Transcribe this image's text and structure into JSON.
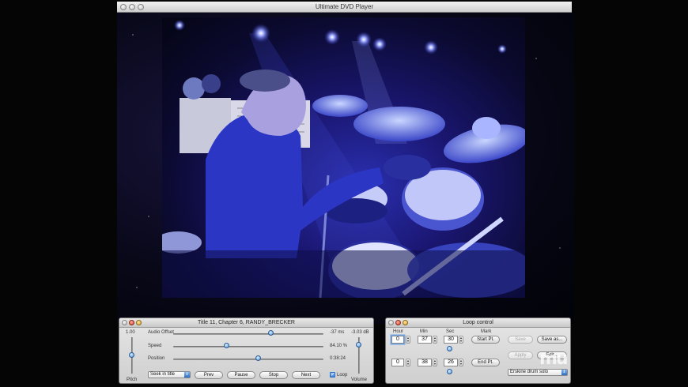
{
  "main_window": {
    "title": "Ultimate DVD Player"
  },
  "playback_panel": {
    "title": "Title 11, Chapter 6, RANDY_BRECKER",
    "pitch": {
      "value": "1.00",
      "label": "Pitch",
      "level": 0.5
    },
    "audio_offset": {
      "label": "Audio Offset",
      "value": "-37 ms",
      "fraction": 0.65
    },
    "speed": {
      "label": "Speed",
      "value": "84.10 %",
      "fraction": 0.36
    },
    "position": {
      "label": "Position",
      "value": "0:38:24",
      "fraction": 0.57
    },
    "volume": {
      "value": "-3.03 dB",
      "label": "Volume",
      "level": 0.78
    },
    "seek_mode": "Seek in title",
    "buttons": {
      "prev": "Prev",
      "pause": "Pause",
      "stop": "Stop",
      "next": "Next"
    },
    "loop_checkbox": {
      "label": "Loop",
      "checked": true
    }
  },
  "loop_panel": {
    "title": "Loop control",
    "headers": {
      "hour": "Hour",
      "min": "Min",
      "sec": "Sec",
      "mark": "Mark"
    },
    "start": {
      "hour": "0",
      "min": "37",
      "sec": "30",
      "button": "Start Pt."
    },
    "end": {
      "hour": "0",
      "min": "38",
      "sec": "26",
      "button": "End Pt."
    },
    "buttons": {
      "save": "Save",
      "save_as": "Save as...",
      "apply": "Apply",
      "edit": "Edit..."
    },
    "preset": "Erskine drum solo"
  },
  "colors": {
    "accent": "#3f7fd0",
    "panel_bg": "#dcdcdc",
    "video_tint": "#2a2fb0"
  }
}
